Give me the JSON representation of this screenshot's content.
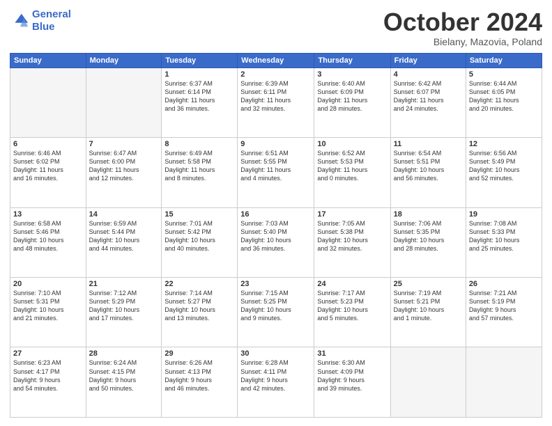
{
  "header": {
    "logo_line1": "General",
    "logo_line2": "Blue",
    "month": "October 2024",
    "location": "Bielany, Mazovia, Poland"
  },
  "weekdays": [
    "Sunday",
    "Monday",
    "Tuesday",
    "Wednesday",
    "Thursday",
    "Friday",
    "Saturday"
  ],
  "weeks": [
    [
      {
        "day": "",
        "text": ""
      },
      {
        "day": "",
        "text": ""
      },
      {
        "day": "1",
        "text": "Sunrise: 6:37 AM\nSunset: 6:14 PM\nDaylight: 11 hours\nand 36 minutes."
      },
      {
        "day": "2",
        "text": "Sunrise: 6:39 AM\nSunset: 6:11 PM\nDaylight: 11 hours\nand 32 minutes."
      },
      {
        "day": "3",
        "text": "Sunrise: 6:40 AM\nSunset: 6:09 PM\nDaylight: 11 hours\nand 28 minutes."
      },
      {
        "day": "4",
        "text": "Sunrise: 6:42 AM\nSunset: 6:07 PM\nDaylight: 11 hours\nand 24 minutes."
      },
      {
        "day": "5",
        "text": "Sunrise: 6:44 AM\nSunset: 6:05 PM\nDaylight: 11 hours\nand 20 minutes."
      }
    ],
    [
      {
        "day": "6",
        "text": "Sunrise: 6:46 AM\nSunset: 6:02 PM\nDaylight: 11 hours\nand 16 minutes."
      },
      {
        "day": "7",
        "text": "Sunrise: 6:47 AM\nSunset: 6:00 PM\nDaylight: 11 hours\nand 12 minutes."
      },
      {
        "day": "8",
        "text": "Sunrise: 6:49 AM\nSunset: 5:58 PM\nDaylight: 11 hours\nand 8 minutes."
      },
      {
        "day": "9",
        "text": "Sunrise: 6:51 AM\nSunset: 5:55 PM\nDaylight: 11 hours\nand 4 minutes."
      },
      {
        "day": "10",
        "text": "Sunrise: 6:52 AM\nSunset: 5:53 PM\nDaylight: 11 hours\nand 0 minutes."
      },
      {
        "day": "11",
        "text": "Sunrise: 6:54 AM\nSunset: 5:51 PM\nDaylight: 10 hours\nand 56 minutes."
      },
      {
        "day": "12",
        "text": "Sunrise: 6:56 AM\nSunset: 5:49 PM\nDaylight: 10 hours\nand 52 minutes."
      }
    ],
    [
      {
        "day": "13",
        "text": "Sunrise: 6:58 AM\nSunset: 5:46 PM\nDaylight: 10 hours\nand 48 minutes."
      },
      {
        "day": "14",
        "text": "Sunrise: 6:59 AM\nSunset: 5:44 PM\nDaylight: 10 hours\nand 44 minutes."
      },
      {
        "day": "15",
        "text": "Sunrise: 7:01 AM\nSunset: 5:42 PM\nDaylight: 10 hours\nand 40 minutes."
      },
      {
        "day": "16",
        "text": "Sunrise: 7:03 AM\nSunset: 5:40 PM\nDaylight: 10 hours\nand 36 minutes."
      },
      {
        "day": "17",
        "text": "Sunrise: 7:05 AM\nSunset: 5:38 PM\nDaylight: 10 hours\nand 32 minutes."
      },
      {
        "day": "18",
        "text": "Sunrise: 7:06 AM\nSunset: 5:35 PM\nDaylight: 10 hours\nand 28 minutes."
      },
      {
        "day": "19",
        "text": "Sunrise: 7:08 AM\nSunset: 5:33 PM\nDaylight: 10 hours\nand 25 minutes."
      }
    ],
    [
      {
        "day": "20",
        "text": "Sunrise: 7:10 AM\nSunset: 5:31 PM\nDaylight: 10 hours\nand 21 minutes."
      },
      {
        "day": "21",
        "text": "Sunrise: 7:12 AM\nSunset: 5:29 PM\nDaylight: 10 hours\nand 17 minutes."
      },
      {
        "day": "22",
        "text": "Sunrise: 7:14 AM\nSunset: 5:27 PM\nDaylight: 10 hours\nand 13 minutes."
      },
      {
        "day": "23",
        "text": "Sunrise: 7:15 AM\nSunset: 5:25 PM\nDaylight: 10 hours\nand 9 minutes."
      },
      {
        "day": "24",
        "text": "Sunrise: 7:17 AM\nSunset: 5:23 PM\nDaylight: 10 hours\nand 5 minutes."
      },
      {
        "day": "25",
        "text": "Sunrise: 7:19 AM\nSunset: 5:21 PM\nDaylight: 10 hours\nand 1 minute."
      },
      {
        "day": "26",
        "text": "Sunrise: 7:21 AM\nSunset: 5:19 PM\nDaylight: 9 hours\nand 57 minutes."
      }
    ],
    [
      {
        "day": "27",
        "text": "Sunrise: 6:23 AM\nSunset: 4:17 PM\nDaylight: 9 hours\nand 54 minutes."
      },
      {
        "day": "28",
        "text": "Sunrise: 6:24 AM\nSunset: 4:15 PM\nDaylight: 9 hours\nand 50 minutes."
      },
      {
        "day": "29",
        "text": "Sunrise: 6:26 AM\nSunset: 4:13 PM\nDaylight: 9 hours\nand 46 minutes."
      },
      {
        "day": "30",
        "text": "Sunrise: 6:28 AM\nSunset: 4:11 PM\nDaylight: 9 hours\nand 42 minutes."
      },
      {
        "day": "31",
        "text": "Sunrise: 6:30 AM\nSunset: 4:09 PM\nDaylight: 9 hours\nand 39 minutes."
      },
      {
        "day": "",
        "text": ""
      },
      {
        "day": "",
        "text": ""
      }
    ]
  ]
}
